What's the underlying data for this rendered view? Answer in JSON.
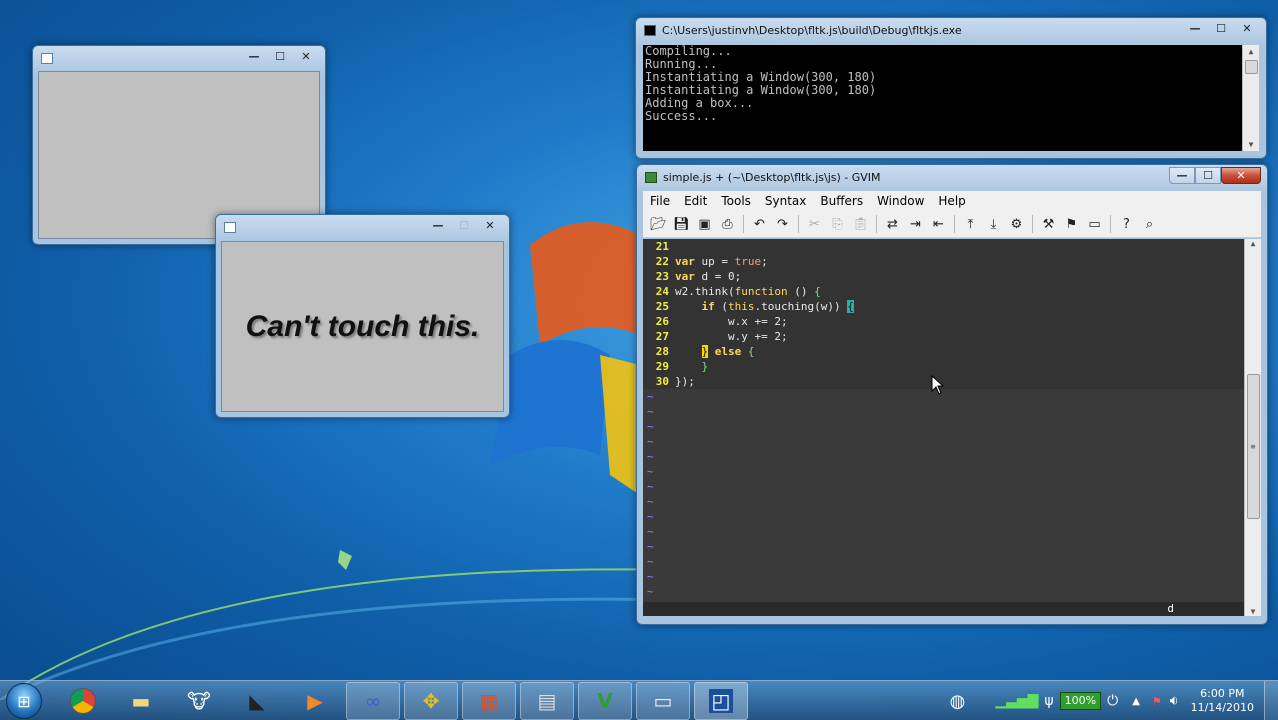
{
  "window_a": {
    "title": ""
  },
  "window_b": {
    "title": "",
    "label": "Can't touch this."
  },
  "console": {
    "title": "C:\\Users\\justinvh\\Desktop\\fltk.js\\build\\Debug\\fltkjs.exe",
    "lines": [
      "Compiling...",
      "Running...",
      "Instantiating a Window(300, 180)",
      "Instantiating a Window(300, 180)",
      "Adding a box...",
      "Success..."
    ]
  },
  "gvim": {
    "title": "simple.js + (~\\Desktop\\fltk.js\\js) - GVIM",
    "menu": [
      "File",
      "Edit",
      "Tools",
      "Syntax",
      "Buffers",
      "Window",
      "Help"
    ],
    "lines": [
      {
        "n": "21",
        "parts": []
      },
      {
        "n": "22",
        "parts": [
          [
            "kw",
            "var"
          ],
          [
            "t",
            " up = "
          ],
          [
            "bool",
            "true"
          ],
          [
            "t",
            ";"
          ]
        ]
      },
      {
        "n": "23",
        "parts": [
          [
            "kw",
            "var"
          ],
          [
            "t",
            " d = 0;"
          ]
        ]
      },
      {
        "n": "24",
        "parts": [
          [
            "t",
            "w2.think("
          ],
          [
            "fn",
            "function"
          ],
          [
            "t",
            " () "
          ],
          [
            "br",
            "{"
          ]
        ]
      },
      {
        "n": "25",
        "parts": [
          [
            "t",
            "    "
          ],
          [
            "kw",
            "if"
          ],
          [
            "t",
            " ("
          ],
          [
            "fn",
            "this"
          ],
          [
            "t",
            ".touching(w)) "
          ],
          [
            "brhl",
            "{"
          ]
        ]
      },
      {
        "n": "26",
        "parts": [
          [
            "t",
            "        w.x += 2;"
          ]
        ]
      },
      {
        "n": "27",
        "parts": [
          [
            "t",
            "        w.y += 2;"
          ]
        ]
      },
      {
        "n": "28",
        "parts": [
          [
            "t",
            "    "
          ],
          [
            "cur",
            "}"
          ],
          [
            "t",
            " "
          ],
          [
            "kw",
            "else"
          ],
          [
            "t",
            " "
          ],
          [
            "br",
            "{"
          ]
        ]
      },
      {
        "n": "29",
        "parts": [
          [
            "t",
            "    "
          ],
          [
            "br",
            "}"
          ]
        ]
      },
      {
        "n": "30",
        "parts": [
          [
            "t",
            "});"
          ]
        ]
      }
    ],
    "tilde_count": 14,
    "status": "d"
  },
  "taskbar": {
    "clock_time": "6:00 PM",
    "clock_date": "11/14/2010",
    "battery": "100%"
  },
  "icons": {
    "minimize": "—",
    "maximize": "☐",
    "close": "✕"
  }
}
